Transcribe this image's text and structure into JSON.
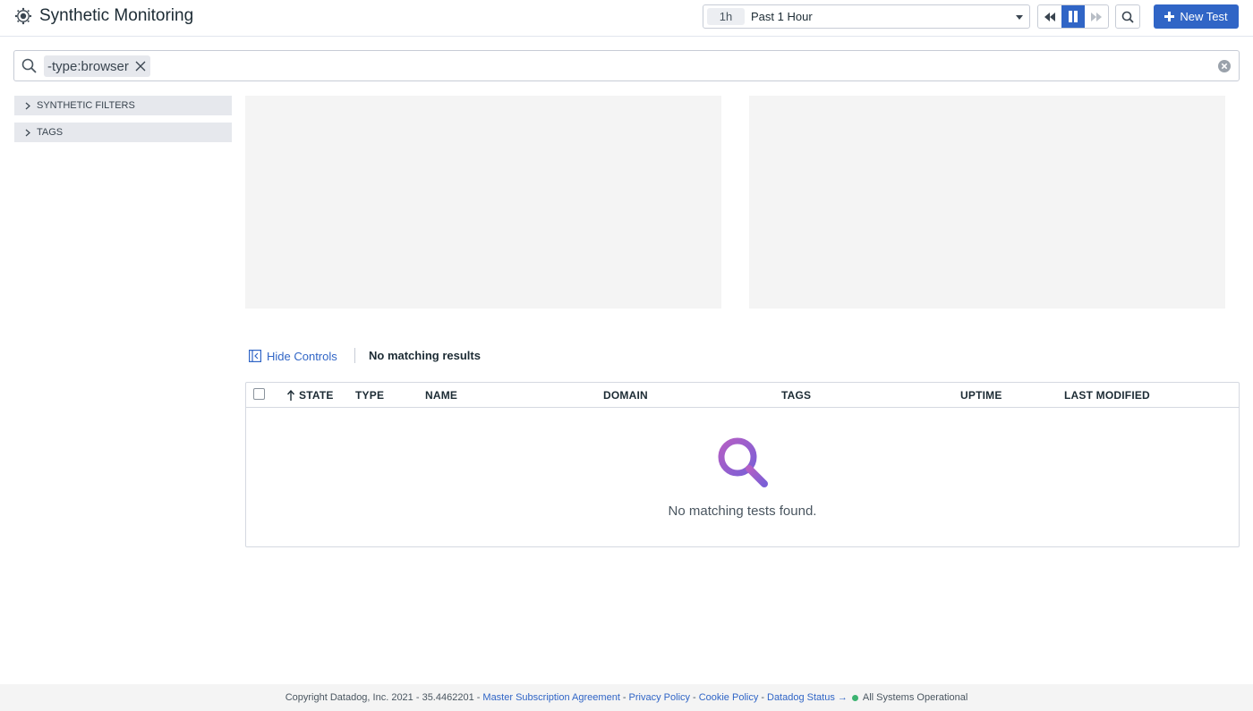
{
  "header": {
    "title": "Synthetic Monitoring",
    "time_chip": "1h",
    "time_range": "Past 1 Hour",
    "new_test_label": "New Test",
    "logo_icon": "datadog-synthetics-icon"
  },
  "search": {
    "query_chip": "-type:browser"
  },
  "facets": [
    {
      "label": "SYNTHETIC FILTERS"
    },
    {
      "label": "TAGS"
    }
  ],
  "controls": {
    "hide_controls_label": "Hide Controls",
    "results_label": "No matching results"
  },
  "table": {
    "columns": [
      "STATE",
      "TYPE",
      "NAME",
      "DOMAIN",
      "TAGS",
      "UPTIME",
      "LAST MODIFIED"
    ],
    "sort_column": "STATE",
    "sort_direction": "ascending",
    "empty_message": "No matching tests found."
  },
  "footer": {
    "copyright": "Copyright Datadog, Inc. 2021 - 35.4462201 -",
    "links": [
      "Master Subscription Agreement",
      "Privacy Policy",
      "Cookie Policy",
      "Datadog Status →"
    ],
    "separator": "-",
    "status": "All Systems Operational"
  },
  "colors": {
    "accent": "#3065c6",
    "status_ok": "#3cb371",
    "empty_icon_start": "#b45fc4",
    "empty_icon_end": "#7b5fd6"
  }
}
